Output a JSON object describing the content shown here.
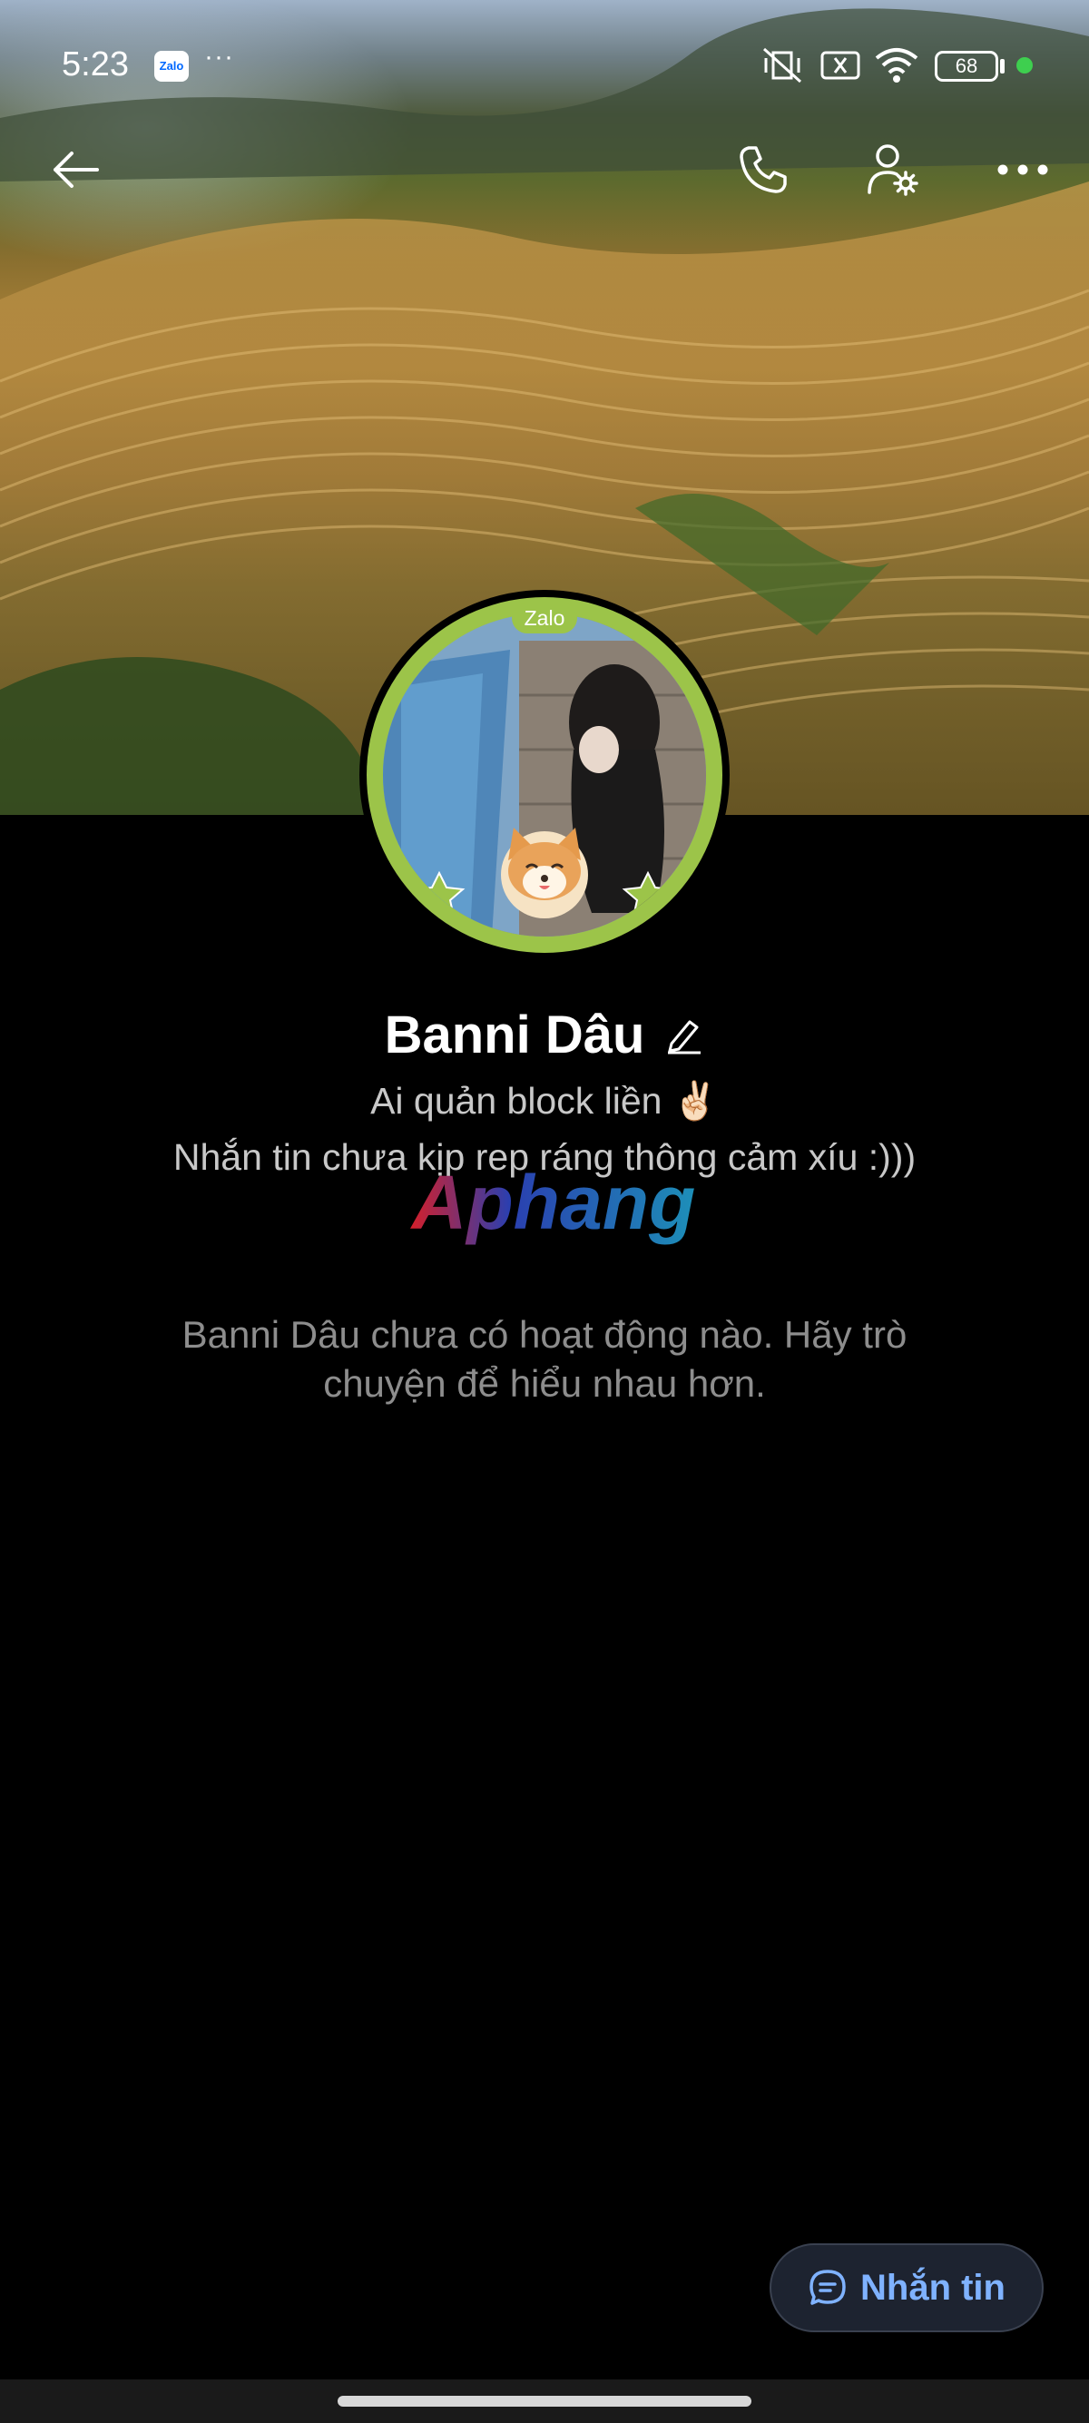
{
  "status_bar": {
    "time": "5:23",
    "app_badge": "Zalo",
    "more": "···",
    "battery": "68"
  },
  "profile": {
    "frame_label": "Zalo",
    "name": "Banni Dâu",
    "bio_line1": "Ai quản block liền ✌🏻",
    "bio_line2": "Nhắn tin chưa kịp rep ráng thông cảm xíu :)))",
    "empty_activity": "Banni Dâu chưa có hoạt động nào. Hãy trò chuyện để hiểu nhau hơn."
  },
  "watermark": "Aphang",
  "actions": {
    "message_button": "Nhắn tin"
  },
  "colors": {
    "background": "#000000",
    "accent_blue": "#7fb2ff",
    "frame_green": "#9cc449"
  }
}
